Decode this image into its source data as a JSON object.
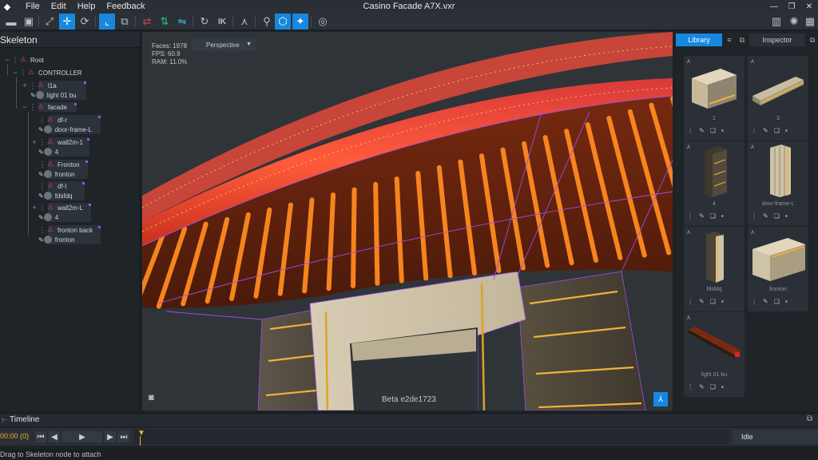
{
  "app": {
    "title": "Casino Facade A7X.vxr",
    "menu": [
      "File",
      "Edit",
      "Help",
      "Feedback"
    ]
  },
  "skeleton": {
    "title": "Skeleton",
    "nodes": [
      {
        "label": "Root"
      },
      {
        "label": "CONTROLLER"
      },
      {
        "label": "l1a",
        "sub": "light 01 bu"
      },
      {
        "label": "facade"
      },
      {
        "label": "df-r",
        "sub": "door-frame-L"
      },
      {
        "label": "wall2m-1",
        "sub": "4"
      },
      {
        "label": "Fronton",
        "sub": "fronton"
      },
      {
        "label": "df-l",
        "sub": "fdsfdq"
      },
      {
        "label": "wall2m-L",
        "sub": "4"
      },
      {
        "label": "fronton back",
        "sub": "fronton"
      }
    ]
  },
  "viewport": {
    "faces": "Faces: 1978",
    "fps": "FPS: 60.9",
    "ram": "RAM: 11.0%",
    "projection": "Perspective",
    "watermark": "Beta e2de1723"
  },
  "library": {
    "tab_library": "Library",
    "tab_inspector": "Inspector",
    "items": [
      {
        "label": "1"
      },
      {
        "label": "3"
      },
      {
        "label": "4"
      },
      {
        "label": "door-frame-L"
      },
      {
        "label": "fdsfdq"
      },
      {
        "label": "fronton"
      },
      {
        "label": "light 01 bu"
      }
    ]
  },
  "timeline": {
    "title": "Timeline",
    "time": "00:00 (0)",
    "state": "Idle"
  },
  "status": "Drag to Skeleton node to attach",
  "colors": {
    "accent": "#1788e0",
    "node_red": "#e2474f",
    "selection": "#a04de6",
    "lights": "#ff8a1f"
  }
}
